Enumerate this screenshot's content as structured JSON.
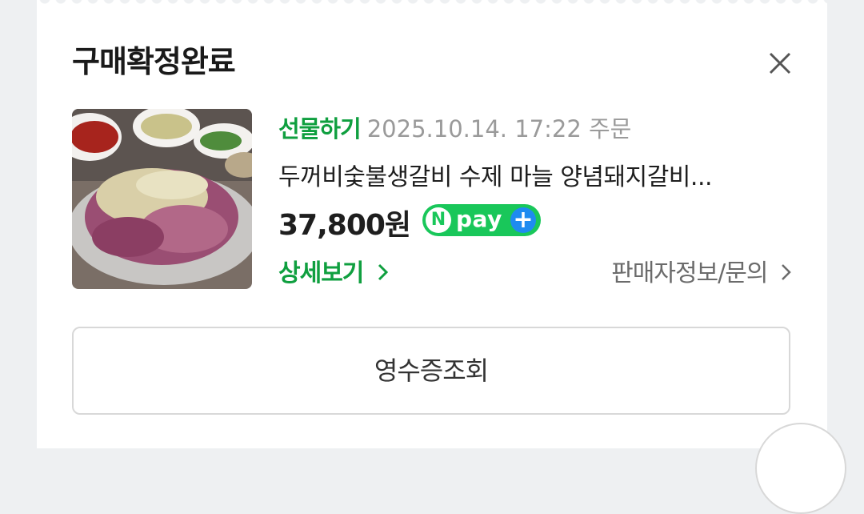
{
  "modal": {
    "title": "구매확정완료"
  },
  "order": {
    "gift_label": "선물하기",
    "order_date": "2025.10.14. 17:22 주문",
    "product_name": "두꺼비숯불생갈비 수제 마늘 양념돼지갈비...",
    "price": "37,800원",
    "npay": {
      "n": "N",
      "pay": "pay",
      "plus": "+"
    },
    "detail_label": "상세보기",
    "seller_label": "판매자정보/문의"
  },
  "buttons": {
    "receipt_label": "영수증조회"
  },
  "colors": {
    "accent_green": "#0f9f3f",
    "npay_green": "#19c75a",
    "npay_blue": "#1e8bf0"
  },
  "icons": [
    "close-icon",
    "chevron-right-icon",
    "npay-logo"
  ]
}
